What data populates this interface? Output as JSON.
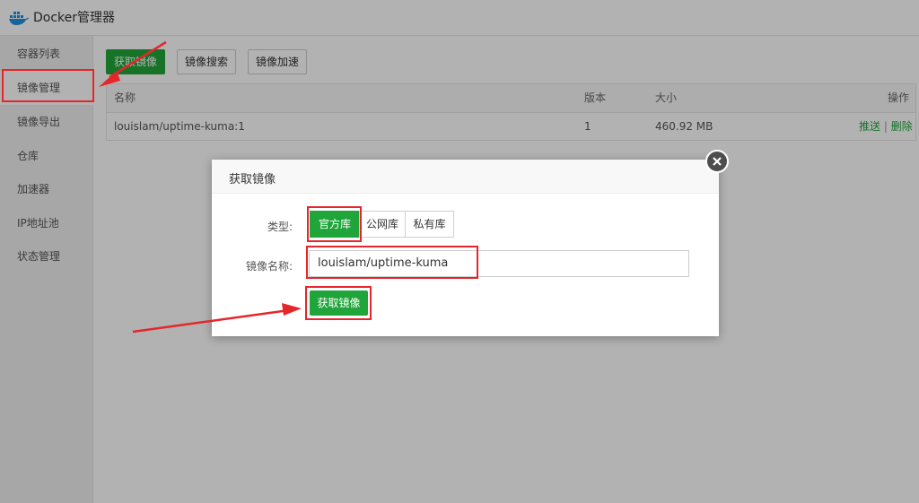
{
  "app": {
    "title": "Docker管理器"
  },
  "sidebar": {
    "items": [
      {
        "label": "容器列表"
      },
      {
        "label": "镜像管理"
      },
      {
        "label": "镜像导出"
      },
      {
        "label": "仓库"
      },
      {
        "label": "加速器"
      },
      {
        "label": "IP地址池"
      },
      {
        "label": "状态管理"
      }
    ],
    "active_index": 1
  },
  "toolbar": {
    "pull_label": "获取镜像",
    "search_label": "镜像搜索",
    "accelerate_label": "镜像加速"
  },
  "table": {
    "columns": [
      "名称",
      "版本",
      "大小",
      "操作"
    ],
    "rows": [
      {
        "name": "louislam/uptime-kuma:1",
        "version": "1",
        "size": "460.92 MB",
        "actions": [
          "推送",
          "删除"
        ],
        "sep": "|"
      }
    ]
  },
  "dialog": {
    "title": "获取镜像",
    "type_label": "类型:",
    "type_options": [
      "官方库",
      "公网库",
      "私有库"
    ],
    "selected_type_index": 0,
    "name_label": "镜像名称:",
    "name_value": "louislam/uptime-kuma",
    "submit_label": "获取镜像"
  },
  "colors": {
    "primary": "#20a53a",
    "highlight": "#e5262b"
  },
  "icons": {
    "logo": "docker-whale-icon",
    "close": "close-icon"
  }
}
